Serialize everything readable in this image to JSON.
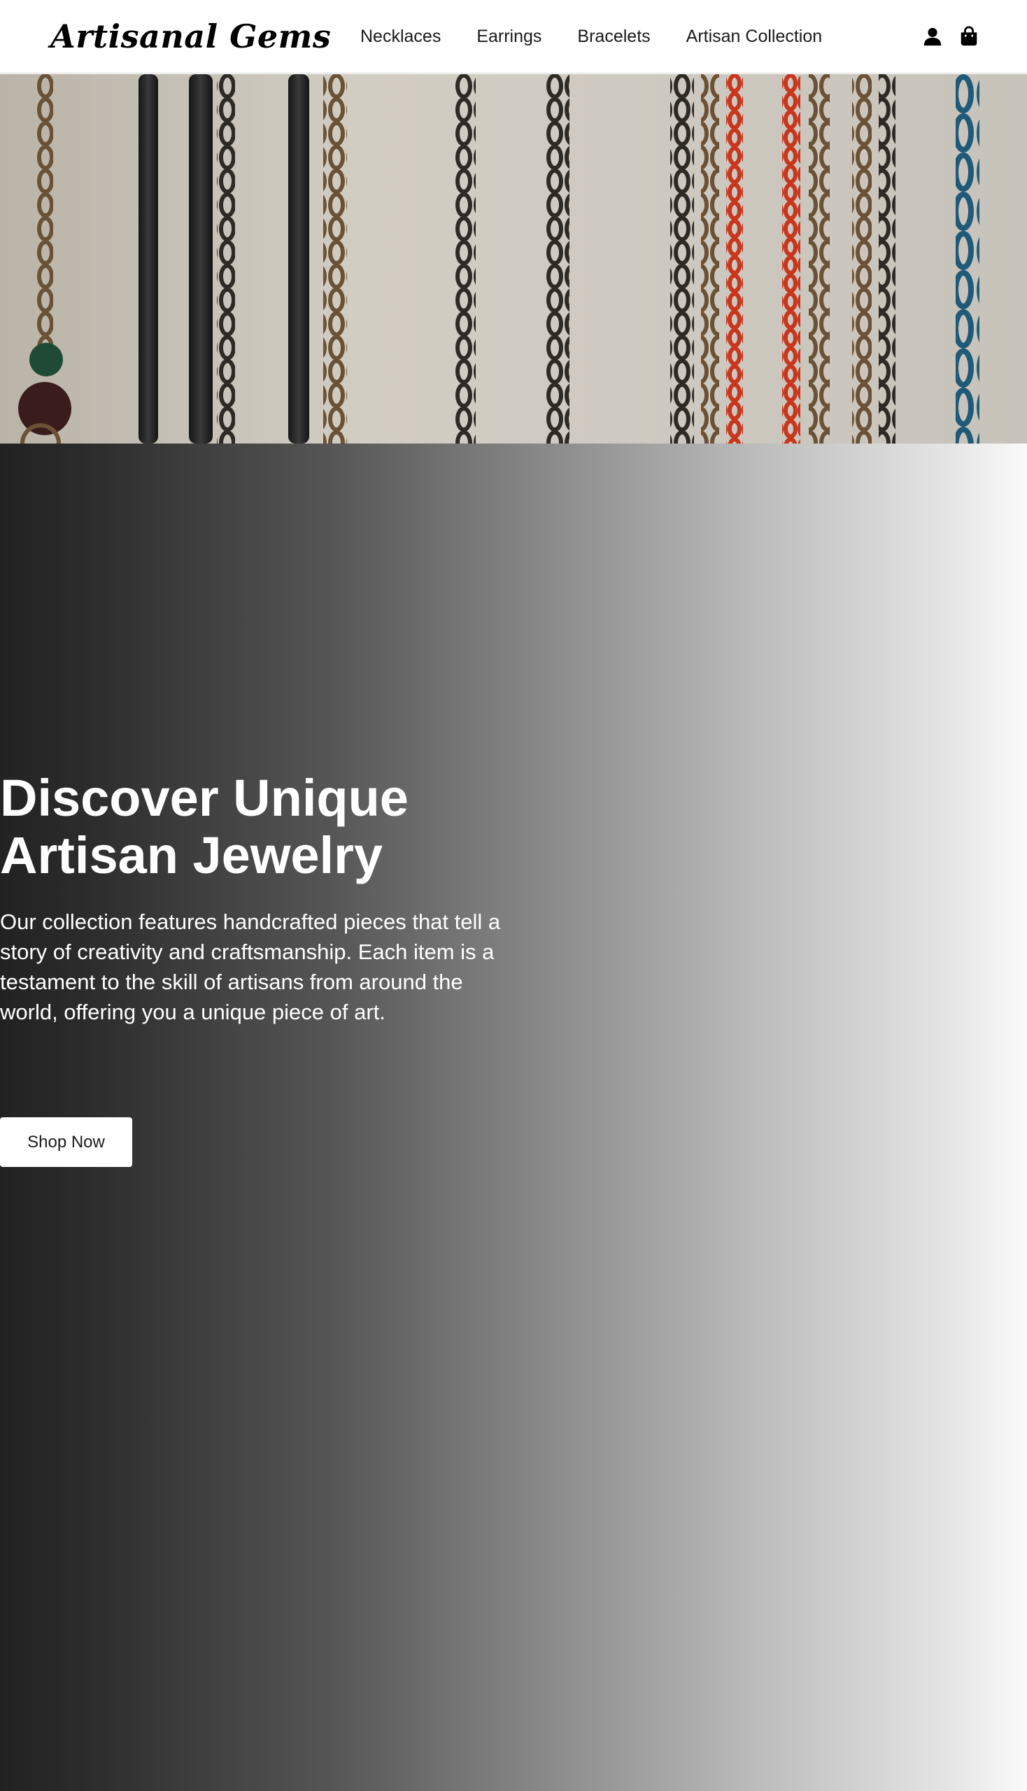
{
  "header": {
    "logo": "Artisanal Gems",
    "nav": [
      "Necklaces",
      "Earrings",
      "Bracelets",
      "Artisan Collection"
    ],
    "icons": [
      "user-icon",
      "shopping-bag-icon"
    ]
  },
  "banner": {
    "description_icon": "jewelry-chains-image"
  },
  "hero": {
    "title": "Discover Unique Artisan Jewelry",
    "text": "Our collection features handcrafted pieces that tell a story of creativity and craftsmanship. Each item is a testament to the skill of artisans from around the world, offering you a unique piece of art.",
    "button": "Shop Now"
  },
  "colors": {
    "header_bg": "#ffffff",
    "gradient_dark": "#222222",
    "gradient_light": "#fafafa",
    "button_bg": "#ffffff",
    "chain_red": "#c8361e",
    "chain_teal": "#1f5a78"
  }
}
